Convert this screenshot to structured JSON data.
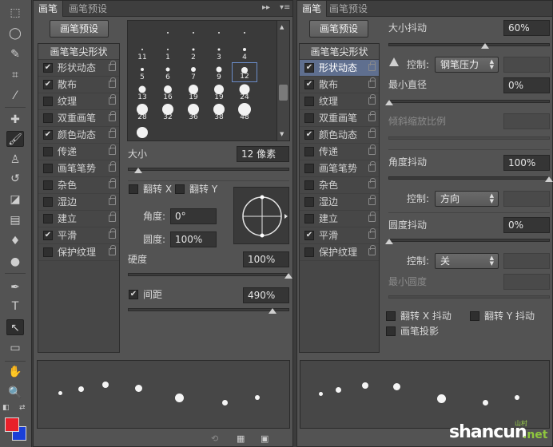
{
  "left_panel": {
    "tabs": [
      "画笔",
      "画笔预设"
    ],
    "preset_button": "画笔预设",
    "list_header": "画笔笔尖形状",
    "items": [
      {
        "label": "形状动态",
        "checked": true
      },
      {
        "label": "散布",
        "checked": true
      },
      {
        "label": "纹理",
        "checked": false
      },
      {
        "label": "双重画笔",
        "checked": false
      },
      {
        "label": "颜色动态",
        "checked": true
      },
      {
        "label": "传递",
        "checked": false
      },
      {
        "label": "画笔笔势",
        "checked": false
      },
      {
        "label": "杂色",
        "checked": false
      },
      {
        "label": "湿边",
        "checked": false
      },
      {
        "label": "建立",
        "checked": false
      },
      {
        "label": "平滑",
        "checked": true
      },
      {
        "label": "保护纹理",
        "checked": false
      }
    ],
    "brush_numbers": [
      "",
      "",
      "",
      "",
      "",
      "11",
      "1",
      "2",
      "3",
      "4",
      "5",
      "6",
      "7",
      "9",
      "12",
      "13",
      "16",
      "19",
      "19",
      "24",
      "28",
      "32",
      "36",
      "38",
      "48",
      "",
      "",
      "",
      "",
      ""
    ],
    "selected_brush": "12",
    "size_label": "大小",
    "size_value": "12 像素",
    "size_level": 0.06,
    "flip_x": "翻转 X",
    "flip_y": "翻转 Y",
    "angle_label": "角度:",
    "angle_value": "0°",
    "roundness_label": "圆度:",
    "roundness_value": "100%",
    "hardness_label": "硬度",
    "hardness_value": "100%",
    "hardness_level": 1.0,
    "spacing_label": "间距",
    "spacing_value": "490%",
    "spacing_checked": true,
    "spacing_level": 0.9
  },
  "right_panel": {
    "tabs": [
      "画笔",
      "画笔预设"
    ],
    "preset_button": "画笔预设",
    "list_header": "画笔笔尖形状",
    "items": [
      {
        "label": "形状动态",
        "checked": true
      },
      {
        "label": "散布",
        "checked": true
      },
      {
        "label": "纹理",
        "checked": false
      },
      {
        "label": "双重画笔",
        "checked": false
      },
      {
        "label": "颜色动态",
        "checked": true
      },
      {
        "label": "传递",
        "checked": false
      },
      {
        "label": "画笔笔势",
        "checked": false
      },
      {
        "label": "杂色",
        "checked": false
      },
      {
        "label": "湿边",
        "checked": false
      },
      {
        "label": "建立",
        "checked": false
      },
      {
        "label": "平滑",
        "checked": true
      },
      {
        "label": "保护纹理",
        "checked": false
      }
    ],
    "size_jitter_label": "大小抖动",
    "size_jitter_value": "60%",
    "size_jitter_level": 0.6,
    "control_label": "控制:",
    "control_pen_value": "钢笔压力",
    "min_diameter_label": "最小直径",
    "min_diameter_value": "0%",
    "min_diameter_level": 0.0,
    "tilt_scale_label": "倾斜缩放比例",
    "angle_jitter_label": "角度抖动",
    "angle_jitter_value": "100%",
    "angle_jitter_level": 1.0,
    "control_direction_value": "方向",
    "roundness_jitter_label": "圆度抖动",
    "roundness_jitter_value": "0%",
    "roundness_jitter_level": 0.0,
    "control_off_value": "关",
    "min_roundness_label": "最小圆度",
    "flip_x_jitter": "翻转 X 抖动",
    "flip_y_jitter": "翻转 Y 抖动",
    "brush_projection": "画笔投影"
  },
  "colors": {
    "foreground": "#e8202a",
    "background": "#1a3fd8",
    "selection": "#5f6f8f"
  },
  "watermark": {
    "text": "shancun",
    "sub": "山村",
    "tld": ".net"
  }
}
